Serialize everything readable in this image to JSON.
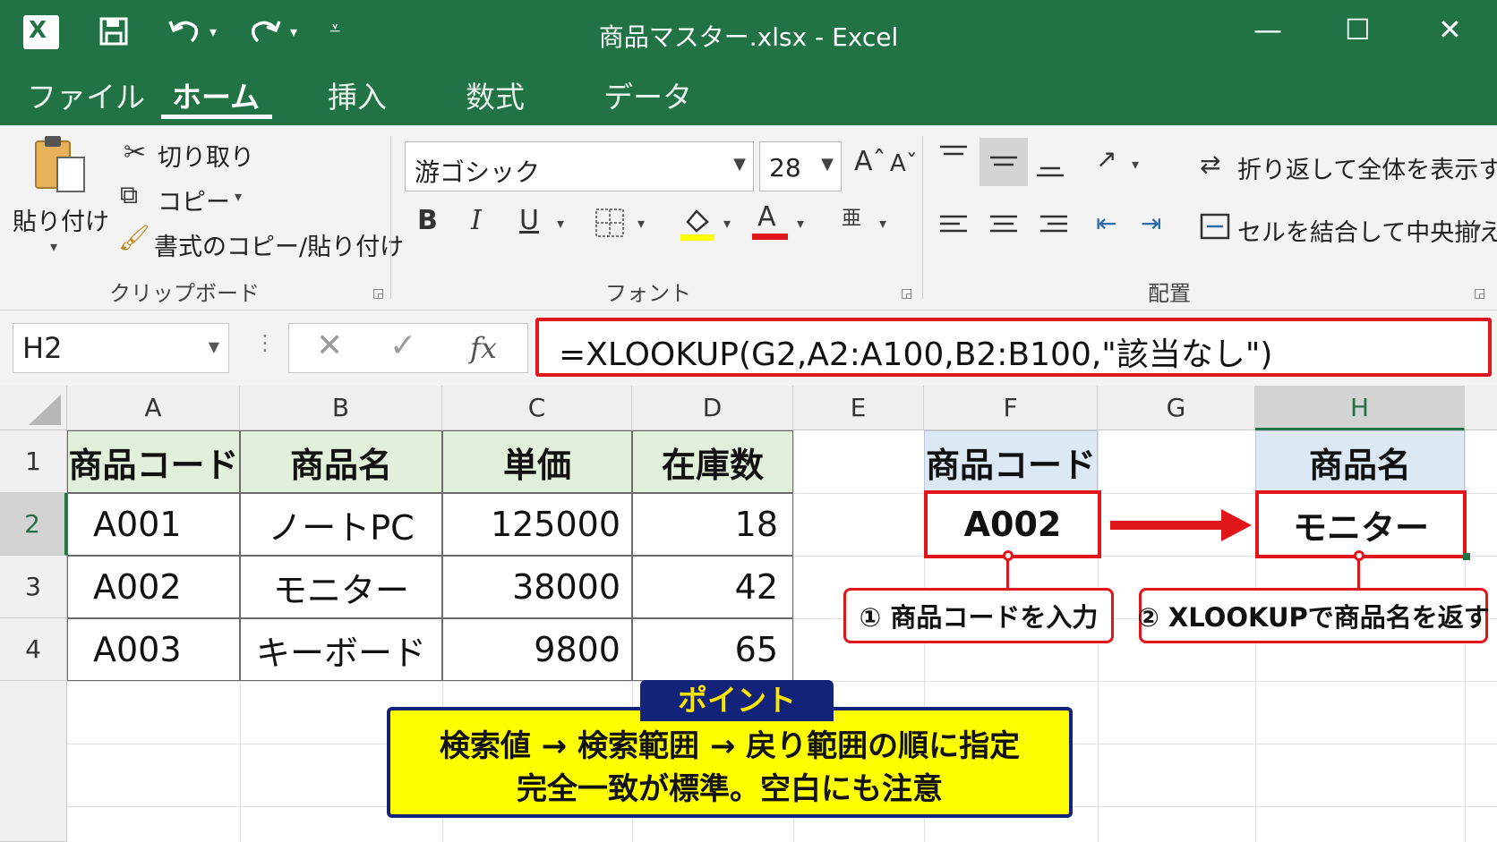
{
  "window": {
    "title": "商品マスター.xlsx - Excel",
    "controls": {
      "minimize": "—",
      "maximize": "☐",
      "close": "✕"
    }
  },
  "menu_tabs": [
    "ファイル",
    "ホーム",
    "挿入",
    "数式",
    "データ"
  ],
  "active_tab": "ホーム",
  "ribbon": {
    "clipboard": {
      "paste": "貼り付け",
      "cut": "切り取り",
      "copy": "コピー",
      "format_painter": "書式のコピー/貼り付け",
      "group_label": "クリップボード"
    },
    "font": {
      "font_name": "游ゴシック",
      "font_size": "28",
      "bold": "B",
      "italic": "I",
      "underline": "U",
      "font_color_letter": "A",
      "group_label": "フォント"
    },
    "alignment": {
      "wrap_text": "折り返して全体を表示する",
      "merge_center": "セルを結合して中央揃え",
      "group_label": "配置"
    }
  },
  "formula_bar": {
    "name_box": "H2",
    "fx": "fx",
    "formula": "=XLOOKUP(G2,A2:A100,B2:B100,\"該当なし\")"
  },
  "columns": [
    "A",
    "B",
    "C",
    "D",
    "E",
    "F",
    "G",
    "H"
  ],
  "rows": [
    "1",
    "2",
    "3",
    "4"
  ],
  "table": {
    "headers": [
      "商品コード",
      "商品名",
      "単価",
      "在庫数"
    ],
    "rows": [
      [
        "A001",
        "ノートPC",
        "125000",
        "18"
      ],
      [
        "A002",
        "モニター",
        "38000",
        "42"
      ],
      [
        "A003",
        "キーボード",
        "9800",
        "65"
      ]
    ]
  },
  "lookup": {
    "input_header": "商品コード",
    "input_value": "A002",
    "output_header": "商品名",
    "output_value": "モニター",
    "note1": "① 商品コードを入力",
    "note2": "② XLOOKUPで商品名を返す"
  },
  "point": {
    "label": "ポイント",
    "line1": "検索値 → 検索範囲 → 戻り範囲の順に指定",
    "line2": "完全一致が標準。空白にも注意"
  }
}
